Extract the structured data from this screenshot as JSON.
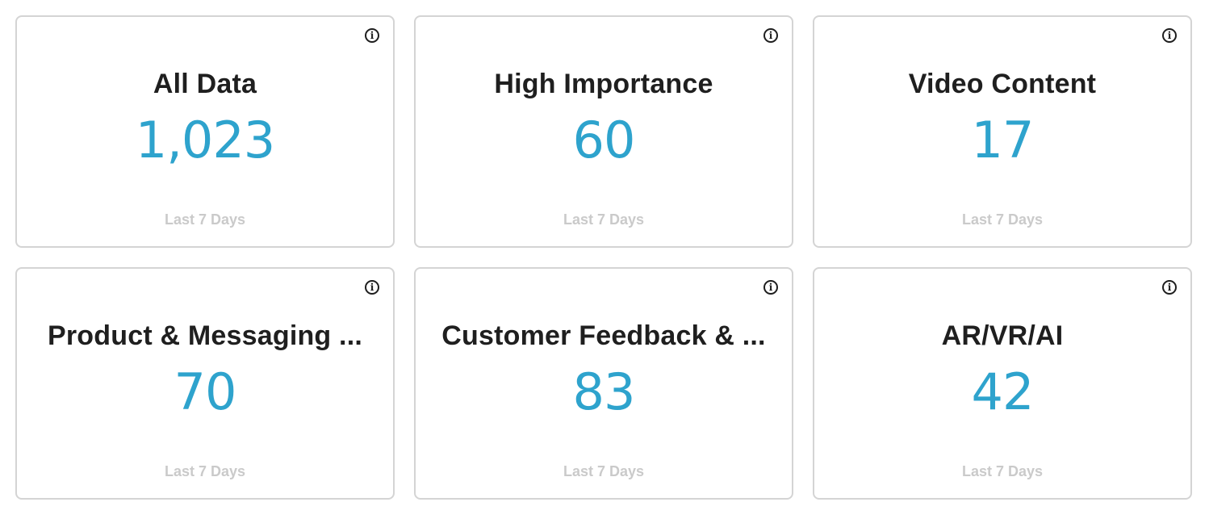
{
  "cards": [
    {
      "title": "All Data",
      "value": "1,023",
      "period": "Last 7 Days",
      "icon": "info-icon"
    },
    {
      "title": "High Importance",
      "value": "60",
      "period": "Last 7 Days",
      "icon": "info-icon"
    },
    {
      "title": "Video Content",
      "value": "17",
      "period": "Last 7 Days",
      "icon": "info-icon"
    },
    {
      "title": "Product & Messaging ...",
      "value": "70",
      "period": "Last 7 Days",
      "icon": "info-icon"
    },
    {
      "title": "Customer Feedback & ...",
      "value": "83",
      "period": "Last 7 Days",
      "icon": "info-icon"
    },
    {
      "title": "AR/VR/AI",
      "value": "42",
      "period": "Last 7 Days",
      "icon": "info-icon"
    }
  ],
  "info_glyph": "i",
  "colors": {
    "value": "#2ea3cd",
    "title": "#1f1f1f",
    "footer": "#cacaca",
    "border": "#d4d4d4"
  }
}
